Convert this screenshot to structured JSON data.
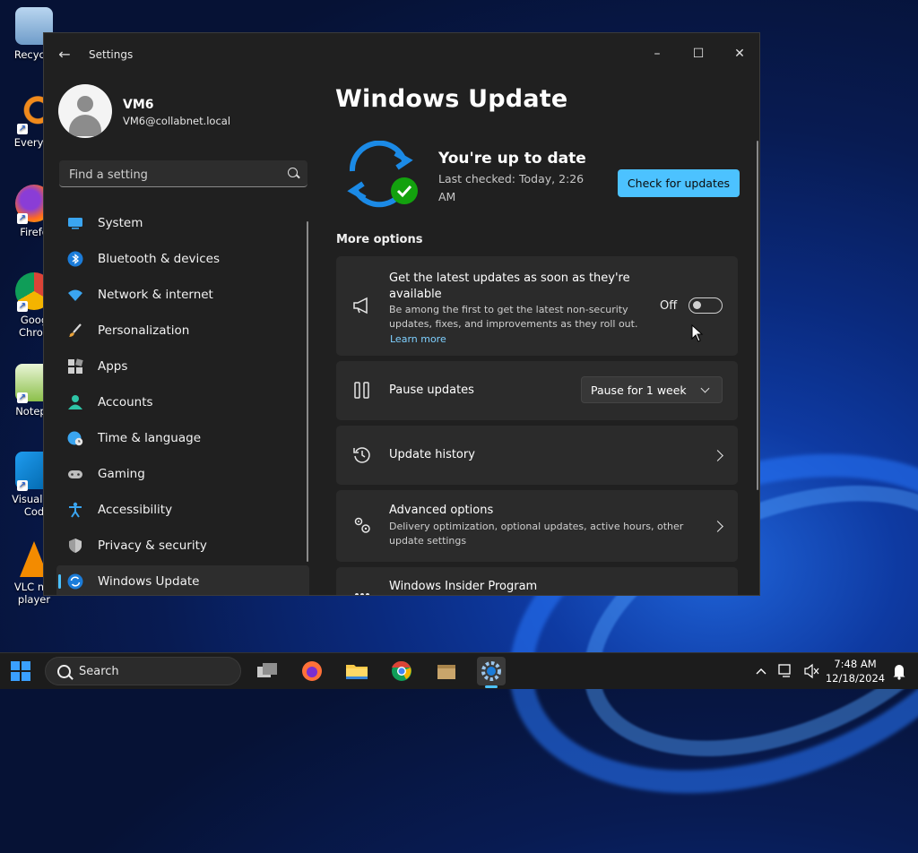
{
  "desktop": {
    "icons": [
      {
        "label": "Recycle"
      },
      {
        "label": "Everyth"
      },
      {
        "label": "Firefo"
      },
      {
        "label": "Goog Chron"
      },
      {
        "label": "Notepa"
      },
      {
        "label": "Visual St Cod"
      },
      {
        "label": "VLC me player"
      }
    ]
  },
  "window": {
    "app_title": "Settings",
    "controls": {
      "minimize": "–",
      "maximize": "☐",
      "close": "✕"
    }
  },
  "user": {
    "name": "VM6",
    "email": "VM6@collabnet.local"
  },
  "search": {
    "placeholder": "Find a setting"
  },
  "nav": {
    "items": [
      {
        "label": "System",
        "icon": "system-icon"
      },
      {
        "label": "Bluetooth & devices",
        "icon": "bluetooth-icon"
      },
      {
        "label": "Network & internet",
        "icon": "wifi-icon"
      },
      {
        "label": "Personalization",
        "icon": "brush-icon"
      },
      {
        "label": "Apps",
        "icon": "apps-icon"
      },
      {
        "label": "Accounts",
        "icon": "accounts-icon"
      },
      {
        "label": "Time & language",
        "icon": "globe-clock-icon"
      },
      {
        "label": "Gaming",
        "icon": "gamepad-icon"
      },
      {
        "label": "Accessibility",
        "icon": "accessibility-icon"
      },
      {
        "label": "Privacy & security",
        "icon": "shield-icon"
      },
      {
        "label": "Windows Update",
        "icon": "windows-update-icon"
      }
    ],
    "active": "Windows Update"
  },
  "main": {
    "title": "Windows Update",
    "status": {
      "title": "You're up to date",
      "subtitle": "Last checked: Today, 2:26 AM"
    },
    "check_button": "Check for updates",
    "more_options": "More options",
    "cards": {
      "latest": {
        "title": "Get the latest updates as soon as they're available",
        "description": "Be among the first to get the latest non-security updates, fixes, and improvements as they roll out.",
        "link": "Learn more",
        "toggle_label": "Off"
      },
      "pause": {
        "title": "Pause updates",
        "dropdown_value": "Pause for 1 week"
      },
      "history": {
        "title": "Update history"
      },
      "advanced": {
        "title": "Advanced options",
        "description": "Delivery optimization, optional updates, active hours, other update settings"
      },
      "insider": {
        "title": "Windows Insider Program"
      }
    }
  },
  "taskbar": {
    "search_label": "Search",
    "clock_time": "7:48 AM",
    "clock_date": "12/18/2024"
  },
  "colors": {
    "accent": "#4cc2ff",
    "window_bg": "#202020",
    "card_bg": "#2b2b2b"
  }
}
